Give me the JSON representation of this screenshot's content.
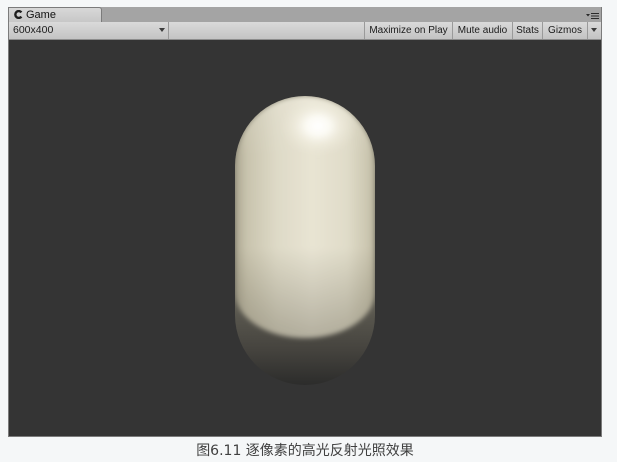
{
  "window": {
    "tab": {
      "label": "Game",
      "icon": "unity-game-icon"
    },
    "tab_menu_icon": "tab-menu-icon"
  },
  "toolbar": {
    "resolution": "600x400",
    "buttons": {
      "maximize_on_play": "Maximize on Play",
      "mute_audio": "Mute audio",
      "stats": "Stats",
      "gizmos": "Gizmos"
    }
  },
  "viewport": {
    "background": "#343434",
    "object_color": "#e8e4d3"
  },
  "caption": "图6.11 逐像素的高光反射光照效果"
}
